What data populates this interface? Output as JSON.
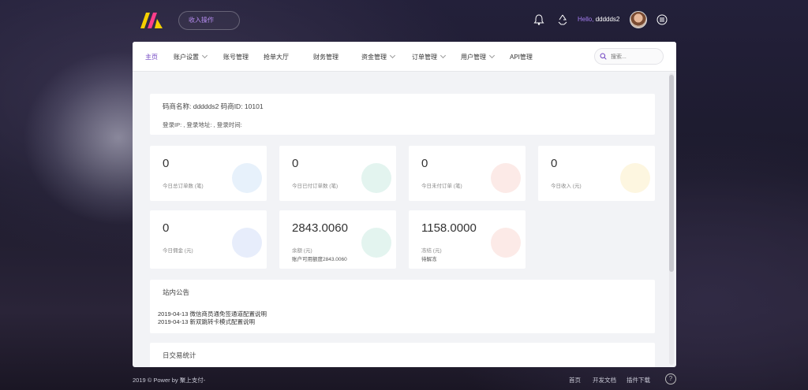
{
  "topbar": {
    "search_pill": "收入操作",
    "hello_prefix": "Hello,",
    "username": "ddddds2",
    "icons": [
      "bell-icon",
      "recycle-icon",
      "menu-icon"
    ]
  },
  "nav": {
    "items": [
      {
        "label": "主页",
        "active": true,
        "has_dropdown": false
      },
      {
        "label": "账户设置",
        "active": false,
        "has_dropdown": true
      },
      {
        "label": "账号管理",
        "active": false,
        "has_dropdown": false
      },
      {
        "label": "抢单大厅",
        "active": false,
        "has_dropdown": false
      },
      {
        "label": "财务管理",
        "active": false,
        "has_dropdown": false
      },
      {
        "label": "资金管理",
        "active": false,
        "has_dropdown": true
      },
      {
        "label": "订单管理",
        "active": false,
        "has_dropdown": true
      },
      {
        "label": "用户管理",
        "active": false,
        "has_dropdown": true
      },
      {
        "label": "API管理",
        "active": false,
        "has_dropdown": false
      }
    ],
    "search_placeholder": "搜索..."
  },
  "info": {
    "line1": "码商名称:  ddddds2  码商ID:  10101",
    "line2": "登录IP:  ,  登录地址:  ,  登录时间:"
  },
  "stats": [
    {
      "value": "0",
      "label": "今日总订单数 (笔)",
      "sub": "",
      "deco_color": "#3a8dde"
    },
    {
      "value": "0",
      "label": "今日已付订单数 (笔)",
      "sub": "",
      "deco_color": "#1aa67a"
    },
    {
      "value": "0",
      "label": "今日未付订单 (笔)",
      "sub": "",
      "deco_color": "#e8563b"
    },
    {
      "value": "0",
      "label": "今日收入 (元)",
      "sub": "",
      "deco_color": "#f0b400"
    },
    {
      "value": "0",
      "label": "今日佣金 (元)",
      "sub": "",
      "deco_color": "#3a6fde"
    },
    {
      "value": "2843.0060",
      "label": "余额 (元)",
      "sub": "账户可用额度2843.0060",
      "deco_color": "#1aa67a"
    },
    {
      "value": "1158.0000",
      "label": "冻结 (元)",
      "sub": "待解冻",
      "deco_color": "#e8563b"
    }
  ],
  "notices": {
    "title": "站内公告",
    "items": [
      "2019-04-13 微信商员通免签通道配置说明",
      "2019-04-13 新双跳转卡模式配置说明"
    ]
  },
  "daily": {
    "title": "日交易统计"
  },
  "footer": {
    "copyright": "2019 © Power by 聚上支付-",
    "links": [
      "首页",
      "开发文档",
      "插件下载"
    ],
    "help": "?"
  },
  "colors": {
    "accent": "#6f42c1",
    "logo_yellow": "#f5d000",
    "logo_pink": "#ff3e8a"
  }
}
